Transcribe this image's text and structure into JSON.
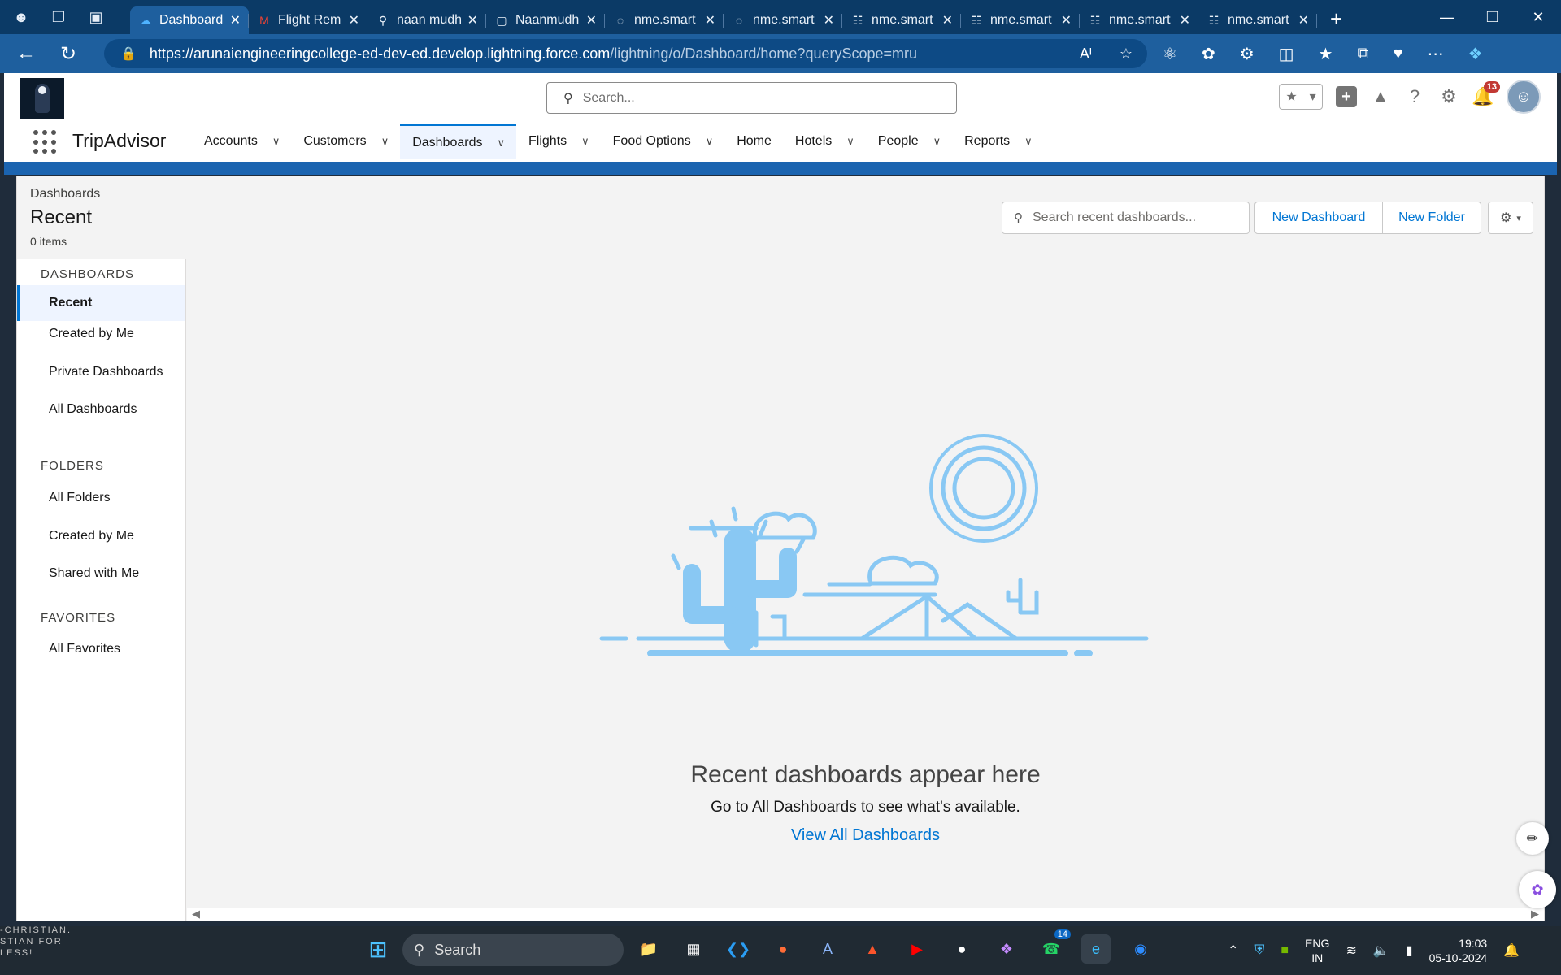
{
  "browser": {
    "tabs": [
      {
        "label": "Dashboard",
        "icon": "salesforce-cloud-icon",
        "active": true
      },
      {
        "label": "Flight Rem",
        "icon": "gmail-icon"
      },
      {
        "label": "naan mudh",
        "icon": "search-icon"
      },
      {
        "label": "Naanmudh",
        "icon": "page-icon"
      },
      {
        "label": "nme.smart",
        "icon": "loading-icon"
      },
      {
        "label": "nme.smart",
        "icon": "loading-icon"
      },
      {
        "label": "nme.smart",
        "icon": "document-icon"
      },
      {
        "label": "nme.smart",
        "icon": "document-icon"
      },
      {
        "label": "nme.smart",
        "icon": "document-icon"
      },
      {
        "label": "nme.smart",
        "icon": "document-icon"
      }
    ],
    "url_main": "https://arunaiengineeringcollege-ed-dev-ed.develop.lightning.force.com",
    "url_path": "/lightning/o/Dashboard/home?queryScope=mru"
  },
  "header": {
    "search_placeholder": "Search...",
    "notification_count": "13",
    "app_name": "TripAdvisor"
  },
  "nav": {
    "items": [
      {
        "label": "Accounts",
        "has_menu": true
      },
      {
        "label": "Customers",
        "has_menu": true
      },
      {
        "label": "Dashboards",
        "has_menu": true,
        "active": true
      },
      {
        "label": "Flights",
        "has_menu": true
      },
      {
        "label": "Food Options",
        "has_menu": true
      },
      {
        "label": "Home",
        "has_menu": false
      },
      {
        "label": "Hotels",
        "has_menu": true
      },
      {
        "label": "People",
        "has_menu": true
      },
      {
        "label": "Reports",
        "has_menu": true
      }
    ]
  },
  "page": {
    "breadcrumb": "Dashboards",
    "title": "Recent",
    "count": "0 items",
    "search_placeholder": "Search recent dashboards...",
    "new_dashboard": "New Dashboard",
    "new_folder": "New Folder"
  },
  "sidebar": {
    "dashboards_heading": "DASHBOARDS",
    "dashboards": [
      "Recent",
      "Created by Me",
      "Private Dashboards",
      "All Dashboards"
    ],
    "folders_heading": "FOLDERS",
    "folders": [
      "All Folders",
      "Created by Me",
      "Shared with Me"
    ],
    "favorites_heading": "FAVORITES",
    "favorites": [
      "All Favorites"
    ]
  },
  "empty_state": {
    "title": "Recent dashboards appear here",
    "subtitle": "Go to All Dashboards to see what's available.",
    "link": "View All Dashboards"
  },
  "taskbar": {
    "search_label": "Search",
    "whatsapp_badge": "14",
    "lang_top": "ENG",
    "lang_bottom": "IN",
    "time": "19:03",
    "date": "05-10-2024",
    "wallpaper_text_1": "-CHRISTIAN.",
    "wallpaper_text_2": "STIAN FOR LESS!"
  },
  "colors": {
    "accent": "#0176d3",
    "illustration": "#89c8f3",
    "band": "#1b64b0"
  }
}
